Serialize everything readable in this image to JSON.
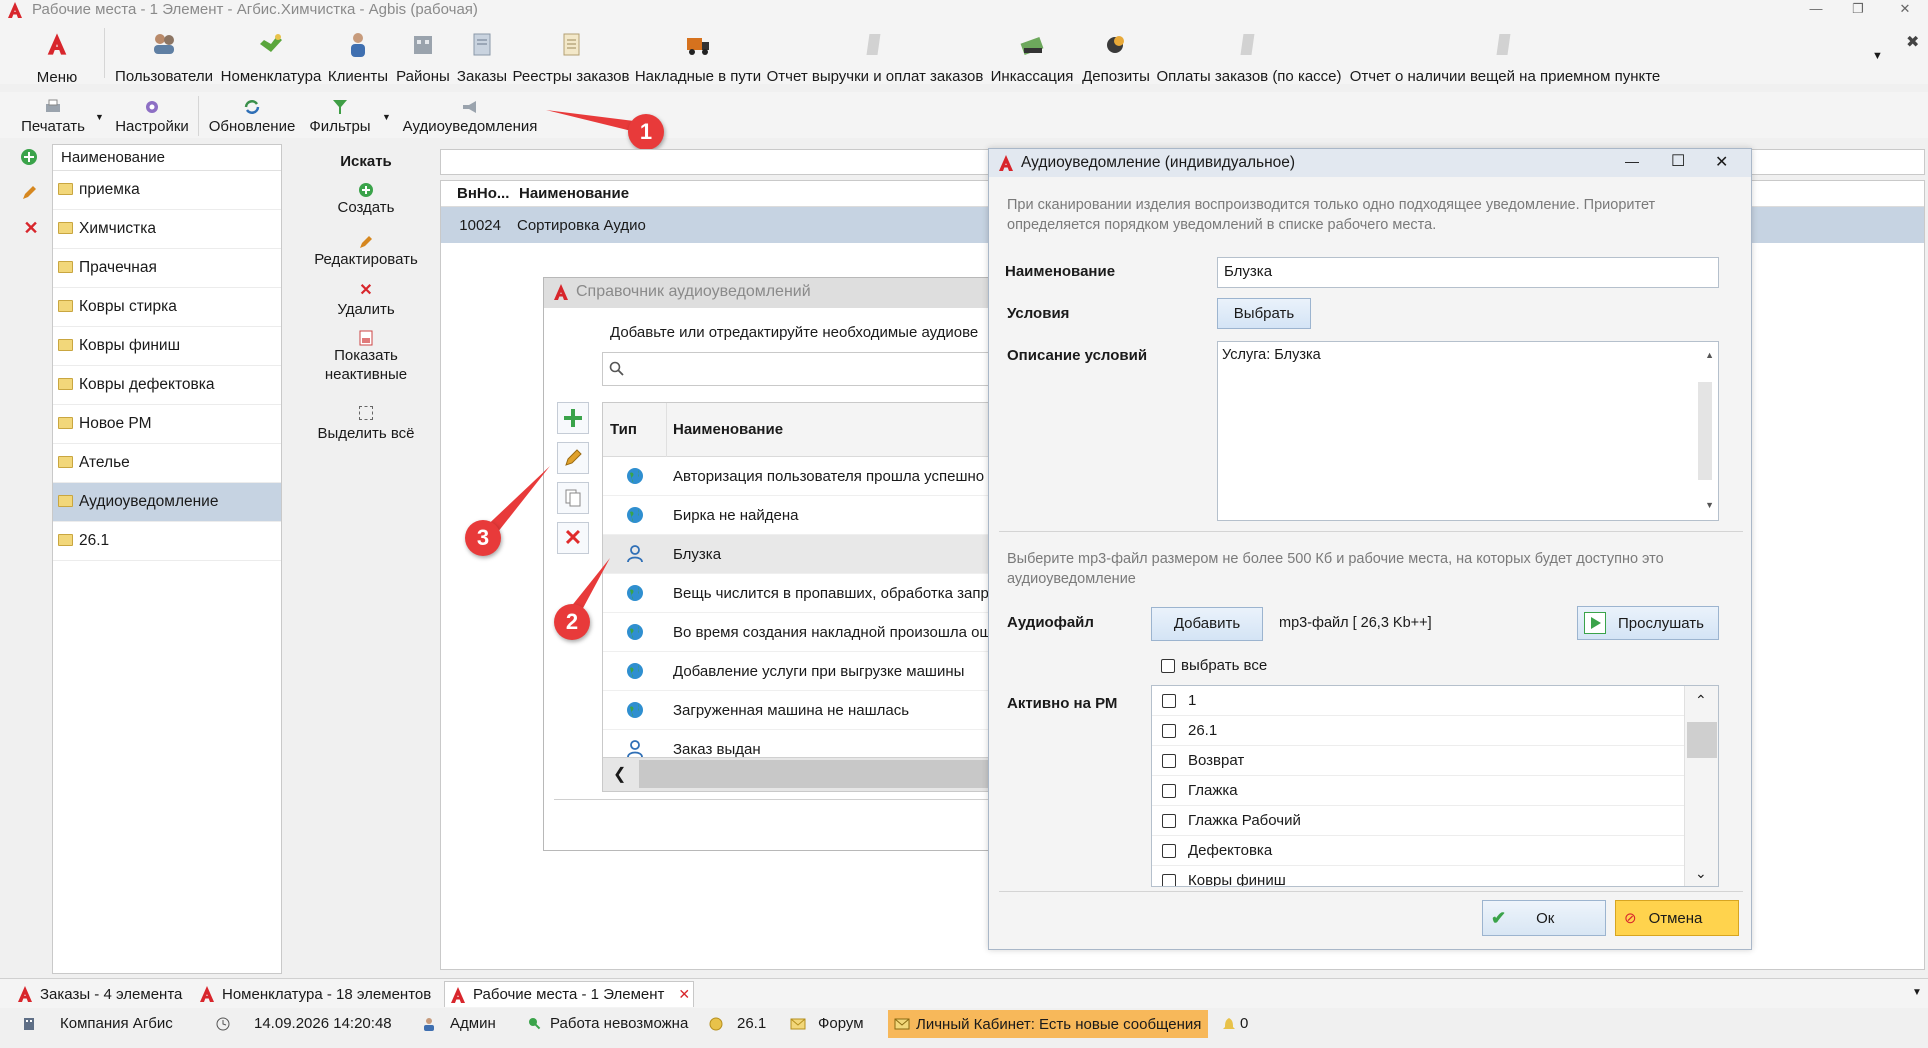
{
  "window": {
    "title": "Рабочие места - 1 Элемент - Агбис.Химчистка - Agbis (рабочая)"
  },
  "ribbon": {
    "menu_label": "Меню",
    "items": [
      {
        "label": "Пользователи",
        "icon": "users-icon"
      },
      {
        "label": "Номенклатура",
        "icon": "nomenclature-icon"
      },
      {
        "label": "Клиенты",
        "icon": "clients-icon"
      },
      {
        "label": "Районы",
        "icon": "districts-icon"
      },
      {
        "label": "Заказы",
        "icon": "orders-icon"
      },
      {
        "label": "Реестры заказов",
        "icon": "registry-icon"
      },
      {
        "label": "Накладные в пути",
        "icon": "truck-icon"
      },
      {
        "label": "Отчет выручки и оплат заказов",
        "icon": "report-icon"
      },
      {
        "label": "Инкассация",
        "icon": "cash-icon"
      },
      {
        "label": "Депозиты",
        "icon": "deposit-icon"
      },
      {
        "label": "Оплаты заказов (по кассе)",
        "icon": "payments-icon"
      },
      {
        "label": "Отчет о наличии вещей на приемном пункте",
        "icon": "report-icon"
      }
    ]
  },
  "toolbar2": {
    "print": "Печатать",
    "settings": "Настройки",
    "refresh": "Обновление",
    "filters": "Фильтры",
    "audio": "Аудиоуведомления"
  },
  "left_list": {
    "header": "Наименование",
    "items": [
      "приемка",
      "Химчистка",
      "Прачечная",
      "Ковры стирка",
      "Ковры финиш",
      "Ковры дефектовка",
      "Новое РМ",
      "Ателье",
      "Аудиоуведомление",
      "26.1"
    ],
    "selected_index": 8
  },
  "actions": {
    "search": "Искать",
    "create": "Создать",
    "edit": "Редактировать",
    "delete": "Удалить",
    "show_inactive_1": "Показать",
    "show_inactive_2": "неактивные",
    "select_all": "Выделить всё"
  },
  "main_grid": {
    "columns": [
      "ВнНо...",
      "Наименование"
    ],
    "rows": [
      {
        "id": "10024",
        "name": "Сортировка Аудио"
      }
    ]
  },
  "audio_directory": {
    "title": "Справочник аудиоуведомлений",
    "hint": "Добавьте или отредактируйте необходимые аудиове",
    "columns": [
      "Тип",
      "Наименование"
    ],
    "rows": [
      {
        "type": "globe",
        "name": "Авторизация пользователя прошла успешно"
      },
      {
        "type": "globe",
        "name": "Бирка не найдена"
      },
      {
        "type": "user",
        "name": "Блузка"
      },
      {
        "type": "globe",
        "name": "Вещь числится в пропавших, обработка запр"
      },
      {
        "type": "globe",
        "name": "Во время создания накладной произошла ош"
      },
      {
        "type": "globe",
        "name": "Добавление услуги при выгрузке машины"
      },
      {
        "type": "globe",
        "name": "Загруженная машина не нашлась"
      },
      {
        "type": "user",
        "name": "Заказ выдан"
      }
    ]
  },
  "audio_individual": {
    "title": "Аудиоуведомление (индивидуальное)",
    "info": "При сканировании изделия воспроизводится только одно подходящее уведомление. Приоритет определяется порядком уведомлений в списке рабочего места.",
    "name_label": "Наименование",
    "name_value": "Блузка",
    "conditions_label": "Условия",
    "choose_button": "Выбрать",
    "conditions_desc_label": "Описание условий",
    "conditions_desc_value": "Услуга: Блузка",
    "file_hint": "Выберите mp3-файл размером не более 500 Кб и рабочие места, на которых будет доступно это аудиоуведомление",
    "audiofile_label": "Аудиофайл",
    "add_button": "Добавить",
    "file_info": "mp3-файл [ 26,3 Kb++]",
    "listen_button": "Прослушать",
    "select_all": "выбрать все",
    "active_label": "Активно на РМ",
    "workplaces": [
      "1",
      "26.1",
      "Возврат",
      "Глажка",
      "Глажка Рабочий",
      "Дефектовка",
      "Ковры финиш"
    ],
    "ok": "Ок",
    "cancel": "Отмена"
  },
  "tabs": [
    {
      "label": "Заказы - 4 элемента"
    },
    {
      "label": "Номенклатура - 18 элементов"
    },
    {
      "label": "Рабочие места - 1 Элемент"
    }
  ],
  "status": {
    "company": "Компания Агбис",
    "datetime": "14.09.2026 14:20:48",
    "user": "Админ",
    "work": "Работа невозможна",
    "place": "26.1",
    "forum": "Форум",
    "cabinet": "Личный Кабинет: Есть новые сообщения",
    "bell_count": "0"
  },
  "annotations": [
    "1",
    "2",
    "3"
  ],
  "colors": {
    "brand_red": "#d8262c",
    "selection": "#c6d3e2",
    "callout": "#e83a3a",
    "cabinet_bg": "#f7b85a"
  }
}
